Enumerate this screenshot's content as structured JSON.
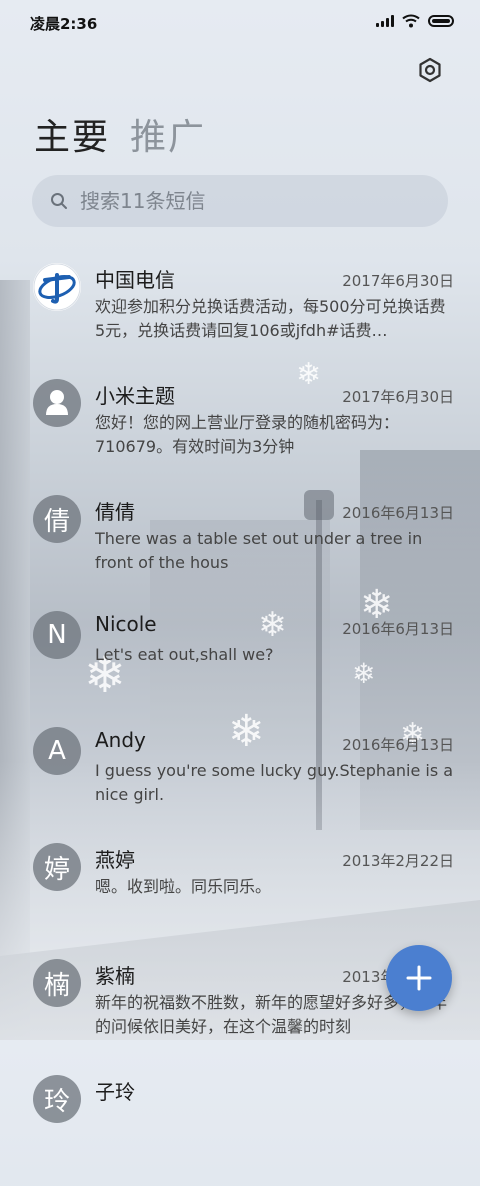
{
  "status_bar": {
    "time": "凌晨2:36",
    "signal_icon": "signal-icon",
    "wifi_icon": "wifi-icon",
    "battery_icon": "battery-icon"
  },
  "header": {
    "settings_icon": "gear-icon"
  },
  "tabs": [
    {
      "label": "主要",
      "active": true
    },
    {
      "label": "推广",
      "active": false
    }
  ],
  "search": {
    "placeholder": "搜索11条短信",
    "icon": "search-icon"
  },
  "messages": [
    {
      "sender": "中国电信",
      "avatar": "china-telecom-logo",
      "date": "2017年6月30日",
      "preview": "欢迎参加积分兑换话费活动，每500分可兑换话费5元，兑换话费请回复106或jfdh#话费…"
    },
    {
      "sender": "小米主题",
      "avatar": "person-icon",
      "date": "2017年6月30日",
      "preview": "您好！您的网上营业厅登录的随机密码为：710679。有效时间为3分钟"
    },
    {
      "sender": "倩倩",
      "avatar": "倩",
      "date": "2016年6月13日",
      "preview": "There was a table set out under a tree in front of the hous"
    },
    {
      "sender": "Nicole",
      "avatar": "N",
      "date": "2016年6月13日",
      "preview": "Let's eat out,shall we?"
    },
    {
      "sender": "Andy",
      "avatar": "A",
      "date": "2016年6月13日",
      "preview": "I guess you're some lucky guy.Stephanie is a nice girl."
    },
    {
      "sender": "燕婷",
      "avatar": "婷",
      "date": "2013年2月22日",
      "preview": "嗯。收到啦。同乐同乐。"
    },
    {
      "sender": "紫楠",
      "avatar": "楠",
      "date": "2013年2月22日",
      "preview": "新年的祝福数不胜数，新年的愿望好多好多，新年的问候依旧美好，在这个温馨的时刻"
    },
    {
      "sender": "子玲",
      "avatar": "玲",
      "date": "",
      "preview": ""
    }
  ],
  "fab": {
    "icon": "plus-icon",
    "color": "#4b7fd0"
  }
}
